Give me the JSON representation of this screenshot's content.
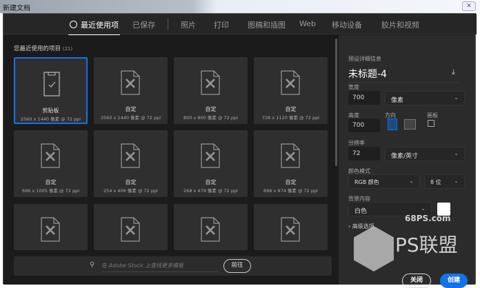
{
  "window": {
    "title": "新建文档",
    "close": "✕"
  },
  "tabs": [
    {
      "label": "最近使用项",
      "active": true
    },
    {
      "label": "已保存"
    },
    {
      "label": "照片"
    },
    {
      "label": "打印"
    },
    {
      "label": "图稿和插图"
    },
    {
      "label": "Web"
    },
    {
      "label": "移动设备"
    },
    {
      "label": "胶片和视频"
    }
  ],
  "recent": {
    "heading": "您最近使用的项目",
    "count": "(21)",
    "items": [
      {
        "name": "剪贴板",
        "size": "2560 x 1440 像素 @ 72 ppi"
      },
      {
        "name": "自定",
        "size": "2560 x 1440 像素 @ 72 ppi"
      },
      {
        "name": "自定",
        "size": "800 x 800 像素 @ 72 ppi"
      },
      {
        "name": "自定",
        "size": "728 x 1120 像素 @ 72 ppi"
      },
      {
        "name": "自定",
        "size": "696 x 1005 像素 @ 72 ppi"
      },
      {
        "name": "自定",
        "size": "254 x 406 像素 @ 72 ppi"
      },
      {
        "name": "自定",
        "size": "268 x 479 像素 @ 72 ppi"
      },
      {
        "name": "自定",
        "size": "696 x 974 像素 @ 72 ppi"
      }
    ]
  },
  "search": {
    "placeholder": "在 Adobe Stock 上查找更多模板",
    "go": "前往"
  },
  "preset": {
    "heading": "预设详细信息",
    "title": "未标题-4",
    "width_label": "宽度",
    "width": "700",
    "width_unit": "像素",
    "height_label": "高度",
    "height": "700",
    "orientation_label": "方向",
    "artboard_label": "画板",
    "res_label": "分辨率",
    "res": "72",
    "res_unit": "像素/英寸",
    "color_label": "颜色模式",
    "color_mode": "RGB 颜色",
    "bit_depth": "8 位",
    "bg_label": "背景内容",
    "bg": "白色",
    "advanced": "高级选项"
  },
  "buttons": {
    "close": "关闭",
    "create": "创建"
  },
  "watermark": {
    "site": "68PS.com",
    "brand": "PS联盟"
  },
  "colors": {
    "accent": "#1473e6"
  }
}
